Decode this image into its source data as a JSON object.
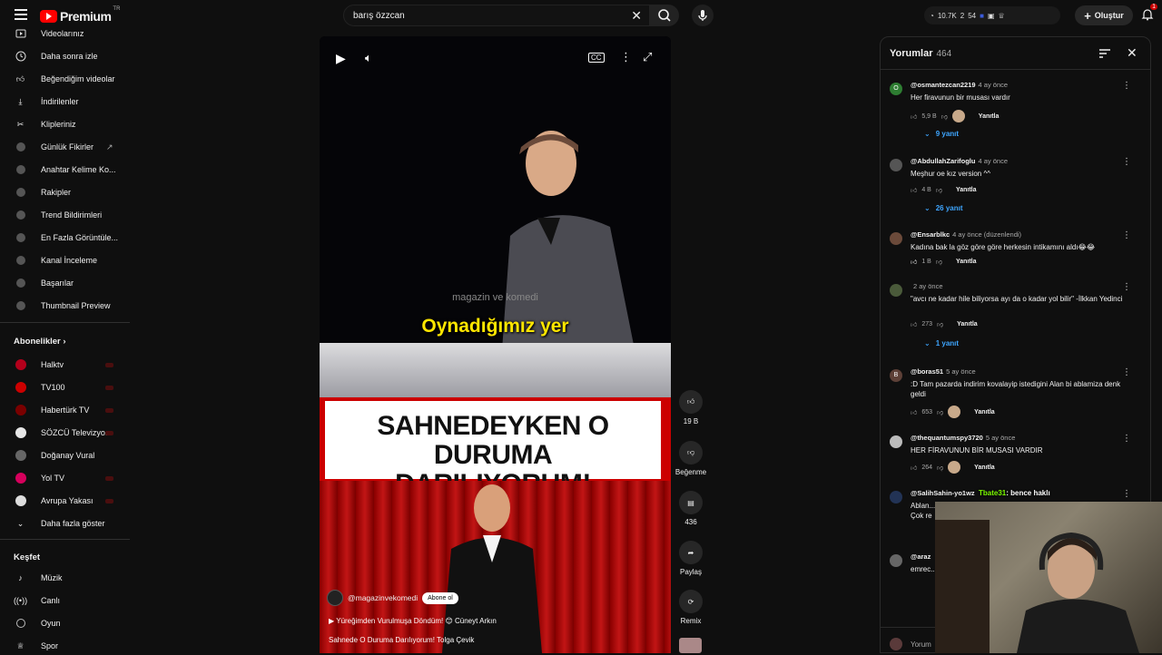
{
  "topbar": {
    "logo_text": "Premium",
    "logo_sup": "TR",
    "search_value": "barış özzcan",
    "ext_views": "10.7K",
    "ext_a": "2",
    "ext_b": "54",
    "create_label": "Oluştur",
    "notif_count": "1"
  },
  "sidebar": {
    "items": [
      {
        "label": "Videolarınız",
        "icon": "video-icon"
      },
      {
        "label": "Daha sonra izle",
        "icon": "clock-icon"
      },
      {
        "label": "Beğendiğim videolar",
        "icon": "thumbs-up-icon"
      },
      {
        "label": "İndirilenler",
        "icon": "download-icon"
      },
      {
        "label": "Klipleriniz",
        "icon": "scissors-icon"
      },
      {
        "label": "Günlük Fikirler",
        "icon": "ext-icon"
      },
      {
        "label": "Anahtar Kelime Ko...",
        "icon": "ext-icon"
      },
      {
        "label": "Rakipler",
        "icon": "ext-icon"
      },
      {
        "label": "Trend Bildirimleri",
        "icon": "ext-icon"
      },
      {
        "label": "En Fazla Görüntüle...",
        "icon": "ext-icon"
      },
      {
        "label": "Kanal İnceleme",
        "icon": "ext-icon"
      },
      {
        "label": "Başarılar",
        "icon": "ext-icon"
      },
      {
        "label": "Thumbnail Preview",
        "icon": "ext-icon"
      }
    ],
    "subs_heading": "Abonelikler",
    "subs": [
      {
        "label": "Halktv",
        "color": "#b3001b"
      },
      {
        "label": "TV100",
        "color": "#cc0000"
      },
      {
        "label": "Habertürk TV",
        "color": "#7a0000"
      },
      {
        "label": "SÖZCÜ Televizyo...",
        "color": "#e6e6e6"
      },
      {
        "label": "Doğanay Vural",
        "color": "#666666"
      },
      {
        "label": "Yol TV",
        "color": "#d6005c"
      },
      {
        "label": "Avrupa Yakası",
        "color": "#dddddd"
      }
    ],
    "show_more": "Daha fazla göster",
    "explore_heading": "Keşfet",
    "explore": [
      {
        "label": "Müzik",
        "icon": "music-icon"
      },
      {
        "label": "Canlı",
        "icon": "live-icon"
      },
      {
        "label": "Oyun",
        "icon": "gamepad-icon"
      },
      {
        "label": "Spor",
        "icon": "trophy-icon"
      }
    ]
  },
  "video": {
    "watermark": "magazin ve komedi",
    "caption": "Oynadığımız yer",
    "banner_line1": "SAHNEDEYKEN O DURUMA",
    "banner_line2": "DARILIYORUM!",
    "channel": "@magazinvekomedi",
    "subscribe": "Abone ol",
    "music": "Yüreğimden Vurulmuşa Döndüm! 😊 Cüneyt Arkın",
    "title": "Sahnede O Duruma Darılıyorum! Tolga Çevik"
  },
  "actions": {
    "like_count": "19 B",
    "dislike_label": "Beğenme",
    "comment_count": "436",
    "share_label": "Paylaş",
    "remix_label": "Remix"
  },
  "comments": {
    "title": "Yorumlar",
    "count": "464",
    "reply_label": "Yanıtla",
    "list": [
      {
        "author": "@osmantezcan2219",
        "time": "4 ay önce",
        "text": "Her firavunun bir musası vardır",
        "likes": "5,9 B",
        "replies": "9 yanıt",
        "avatar_color": "#2e7d32",
        "initial": "O"
      },
      {
        "author": "@AbdullahZarifoglu",
        "time": "4 ay önce",
        "text": "Meşhur oe kız version ^^",
        "likes": "4 B",
        "replies": "26 yanıt",
        "avatar_color": "#555555",
        "initial": ""
      },
      {
        "author": "@Ensarblkc",
        "time": "4 ay önce (düzenlendi)",
        "text": "Kadına bak la göz göre göre herkesin intikamını aldı😂😂",
        "likes": "1 B",
        "replies": "",
        "avatar_color": "#6b4a3a",
        "initial": ""
      },
      {
        "author": "",
        "time": "2 ay önce",
        "text": "\"avcı ne kadar hile biliyorsa ayı da o kadar yol bilir\" -İlkkan Yedinci",
        "likes": "273",
        "replies": "1 yanıt",
        "avatar_color": "#4a5a3a",
        "initial": ""
      },
      {
        "author": "@boras51",
        "time": "5 ay önce",
        "text": ":D Tam pazarda indirim kovalayip istedigini Alan bi ablamiza denk geldi",
        "likes": "653",
        "replies": "",
        "avatar_color": "#5d4037",
        "initial": "B"
      },
      {
        "author": "@thequantumspy3720",
        "time": "5 ay önce",
        "text": "HER FİRAVUNUN BİR MUSASI VARDIR",
        "likes": "264",
        "replies": "",
        "avatar_color": "#bbbbbb",
        "initial": ""
      },
      {
        "author": "@SalihSahin-yo1wz",
        "time": "",
        "text": "Ablan...",
        "likes": "",
        "replies": "",
        "avatar_color": "#223355",
        "initial": ""
      },
      {
        "author": "@araz",
        "time": "",
        "text": "emrec... istiyor",
        "likes": "",
        "replies": "",
        "avatar_color": "#666666",
        "initial": ""
      }
    ],
    "partial_line": "Çok re",
    "footer_partial": "Yorum"
  },
  "stream_chat": {
    "user": "Tbate31",
    "message": ": bence haklı"
  }
}
